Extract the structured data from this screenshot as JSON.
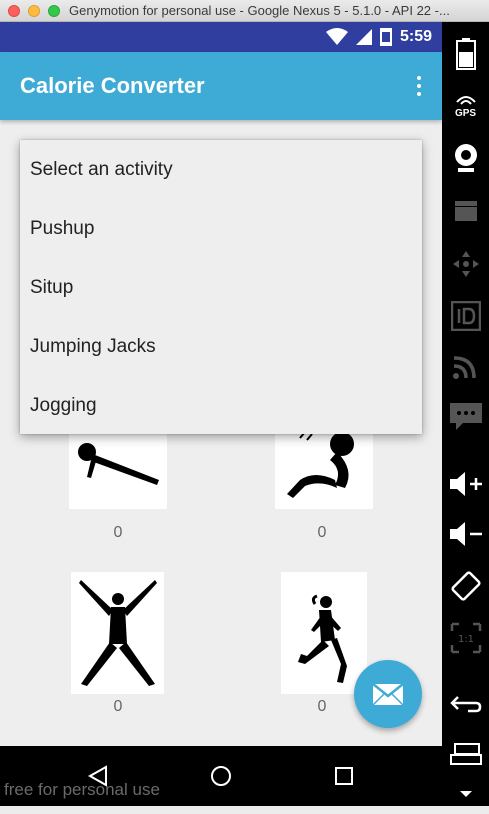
{
  "window": {
    "title": "Genymotion for personal use - Google Nexus 5 - 5.1.0 - API 22 -..."
  },
  "status_bar": {
    "time": "5:59",
    "icons": [
      "wifi-icon",
      "signal-icon",
      "sim-icon",
      "battery-icon"
    ]
  },
  "app_bar": {
    "title": "Calorie Converter",
    "menu_icon": "overflow-menu-icon"
  },
  "dropdown": {
    "items": [
      {
        "label": "Select an activity"
      },
      {
        "label": "Pushup"
      },
      {
        "label": "Situp"
      },
      {
        "label": "Jumping Jacks"
      },
      {
        "label": "Jogging"
      }
    ]
  },
  "activities": [
    {
      "name": "pushup",
      "icon": "pushup-icon",
      "count": "0"
    },
    {
      "name": "situp",
      "icon": "situp-icon",
      "count": "0"
    },
    {
      "name": "jumping-jacks",
      "icon": "jumping-jacks-icon",
      "count": "0"
    },
    {
      "name": "jogging",
      "icon": "jogging-icon",
      "count": "0"
    }
  ],
  "fab": {
    "icon": "email-icon"
  },
  "nav_bar": {
    "icons": [
      "back-icon",
      "home-icon",
      "recents-icon"
    ]
  },
  "watermark": "free for personal use",
  "toolbar": {
    "icons": [
      "battery-icon",
      "gps-icon",
      "webcam-icon",
      "capture-icon",
      "dpad-icon",
      "id-icon",
      "rss-icon",
      "sms-icon",
      "volume-up-icon",
      "volume-down-icon",
      "rotate-icon",
      "scale-icon",
      "back-icon",
      "recent-apps-icon",
      "menu-icon"
    ],
    "gps_label": "GPS",
    "scale_label": "1:1"
  },
  "colors": {
    "status_bar": "#303f9f",
    "app_bar": "#3eaad6",
    "fab": "#3eaad6",
    "background": "#eeeeee"
  }
}
